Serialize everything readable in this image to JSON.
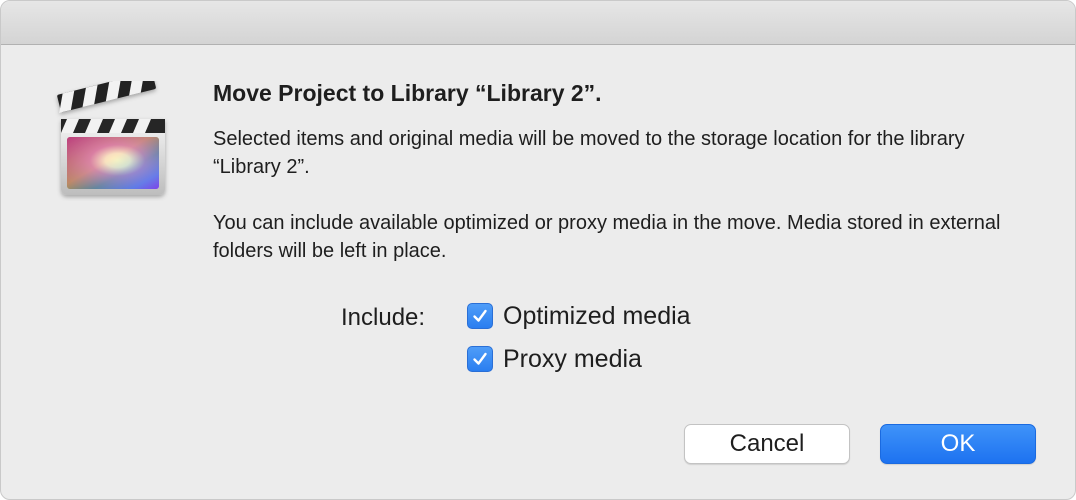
{
  "dialog": {
    "title": "Move Project to Library “Library 2”.",
    "message_1": "Selected items and original media will be moved to the storage location for the library “Library 2”.",
    "message_2": "You can include available optimized or proxy media in the move. Media stored in external folders will be left in place.",
    "app_icon": "final-cut-pro-clapperboard-icon"
  },
  "include": {
    "label": "Include:",
    "options": [
      {
        "label": "Optimized media",
        "checked": true
      },
      {
        "label": "Proxy media",
        "checked": true
      }
    ]
  },
  "buttons": {
    "cancel_label": "Cancel",
    "ok_label": "OK"
  },
  "colors": {
    "accent": "#2a7ef0",
    "window_background": "#ececec"
  }
}
